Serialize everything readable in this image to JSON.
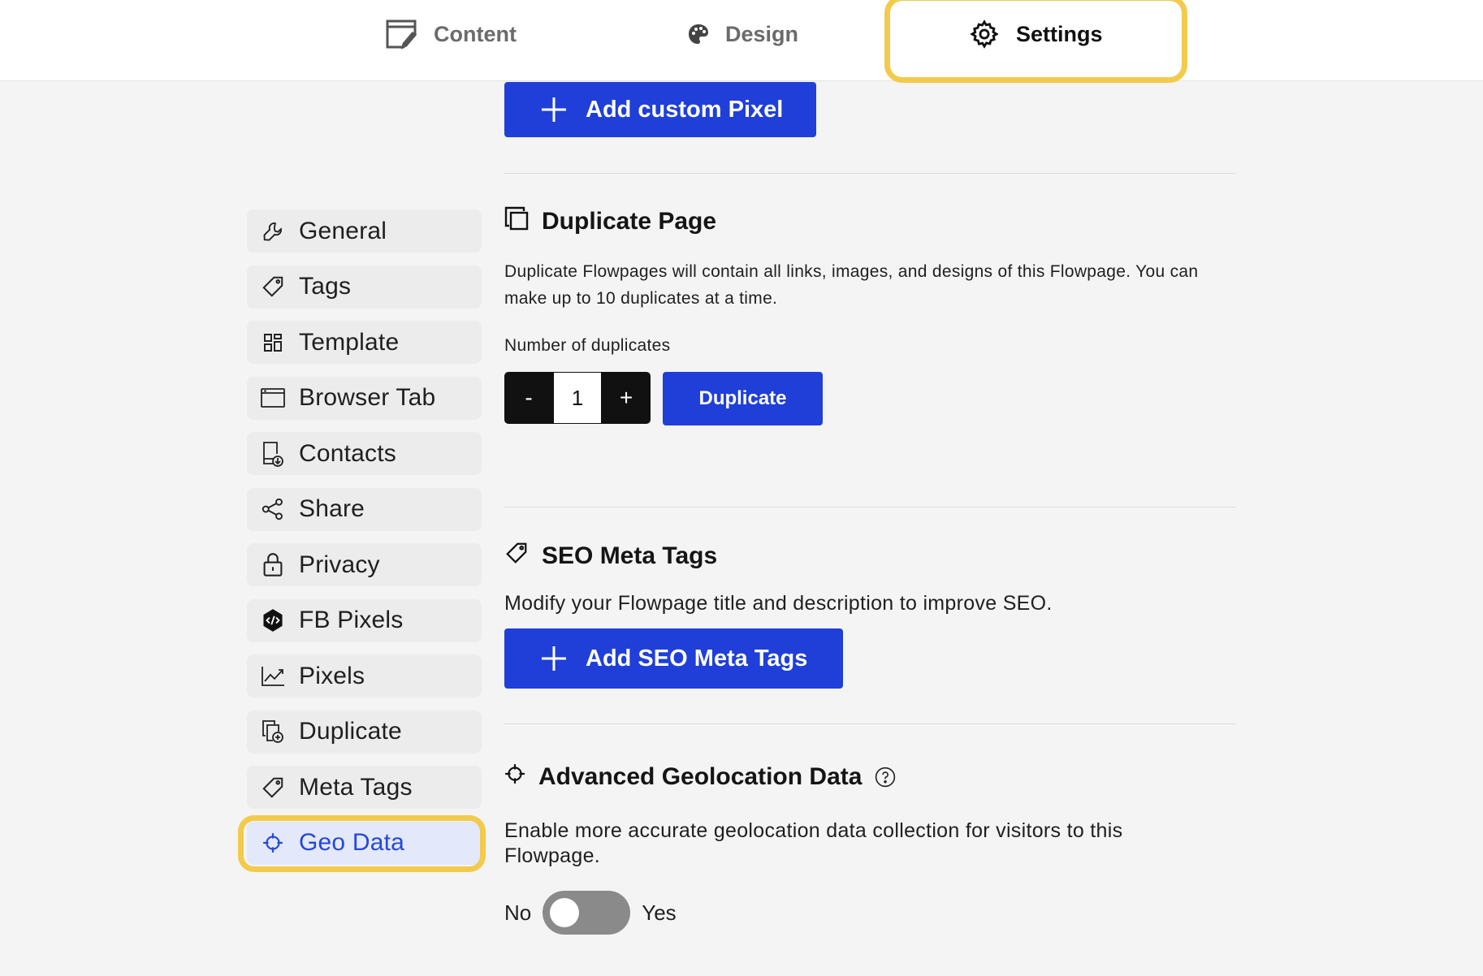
{
  "tabs": {
    "content": "Content",
    "design": "Design",
    "settings": "Settings"
  },
  "sidebar": {
    "items": [
      {
        "label": "General",
        "icon": "wrench-icon"
      },
      {
        "label": "Tags",
        "icon": "tag-icon"
      },
      {
        "label": "Template",
        "icon": "template-icon"
      },
      {
        "label": "Browser Tab",
        "icon": "browser-tab-icon"
      },
      {
        "label": "Contacts",
        "icon": "contacts-icon"
      },
      {
        "label": "Share",
        "icon": "share-icon"
      },
      {
        "label": "Privacy",
        "icon": "lock-icon"
      },
      {
        "label": "FB Pixels",
        "icon": "code-hexagon-icon"
      },
      {
        "label": "Pixels",
        "icon": "chart-line-icon"
      },
      {
        "label": "Duplicate",
        "icon": "duplicate-icon"
      },
      {
        "label": "Meta Tags",
        "icon": "tag-icon"
      },
      {
        "label": "Geo Data",
        "icon": "crosshair-icon"
      }
    ],
    "active": "Geo Data"
  },
  "pixels": {
    "add_button": "Add custom Pixel"
  },
  "duplicate": {
    "title": "Duplicate Page",
    "description": "Duplicate Flowpages will contain all links, images, and designs of this Flowpage. You can make up to 10 duplicates at a time.",
    "count_label": "Number of duplicates",
    "minus": "-",
    "plus": "+",
    "count_value": "1",
    "button": "Duplicate"
  },
  "seo": {
    "title": "SEO Meta Tags",
    "description": "Modify your Flowpage title and description to improve SEO.",
    "add_button": "Add SEO Meta Tags"
  },
  "geo": {
    "title": "Advanced Geolocation Data",
    "description": "Enable more accurate geolocation data collection for visitors to this Flowpage.",
    "toggle_off_label": "No",
    "toggle_on_label": "Yes",
    "enabled": false
  },
  "colors": {
    "accent": "#1f3fd8",
    "highlight": "#f2cb4d",
    "active_text": "#2449d8"
  }
}
